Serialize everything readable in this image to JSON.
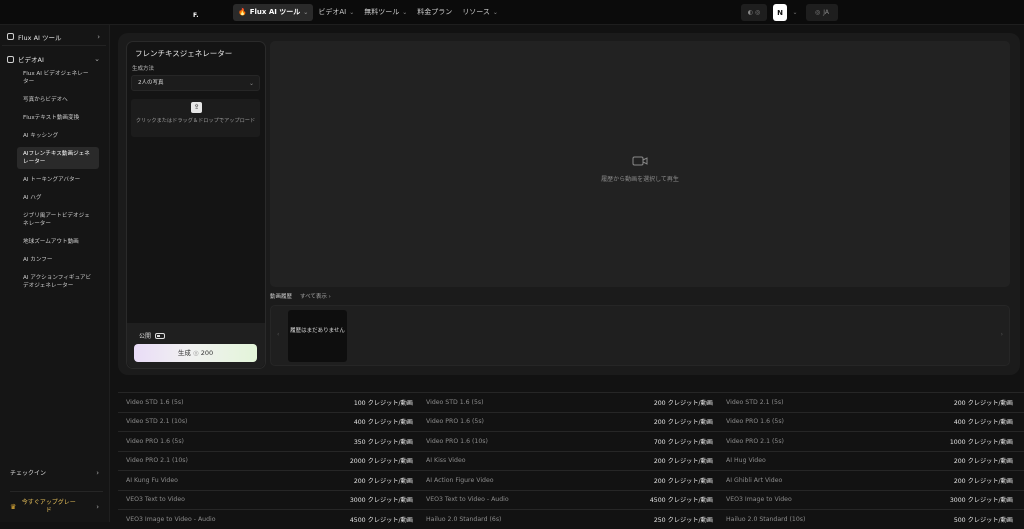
{
  "topbar": {
    "logo": "F",
    "nav": [
      {
        "label": "Flux AI ツール",
        "active": true
      },
      {
        "label": "ビデオAI",
        "active": false
      },
      {
        "label": "無料ツール",
        "active": false
      },
      {
        "label": "料金プラン",
        "active": false
      },
      {
        "label": "リソース",
        "active": false
      }
    ],
    "theme_toggle": "◐ ◎",
    "user_initial": "N",
    "language": "JA"
  },
  "sidebar": {
    "sections": [
      {
        "label": "Flux AI ツール"
      },
      {
        "label": "ビデオAI"
      }
    ],
    "items": [
      "Flux AI ビデオジェネレーター",
      "写真からビデオへ",
      "Fluxテキスト動画変換",
      "AI キッシング",
      "AIフレンチキス動画ジェネレーター",
      "AI トーキングアバター",
      "AI ハグ",
      "ジブリ風アートビデオジェネレーター",
      "地球ズームアウト動画",
      "AI カンフー",
      "AI アクションフィギュアビデオジェネレーター"
    ],
    "checkin": "チェックイン",
    "upgrade": "今すぐアップグレード"
  },
  "panel": {
    "title": "フレンチキスジェネレーター",
    "method_label": "生成方法",
    "method_value": "2人の写真",
    "upload_text": "クリックまたはドラッグ＆ドロップでアップロード",
    "public_label": "公開",
    "generate_label": "生成",
    "generate_cost": "200"
  },
  "preview": {
    "text": "履歴から動画を選択して再生"
  },
  "history": {
    "title": "動画履歴",
    "show_all": "すべて表示",
    "empty": "履歴はまだありません"
  },
  "pricing": [
    [
      {
        "name": "Video STD 1.6 (5s)",
        "value": "100 クレジット/動画"
      },
      {
        "name": "Video STD 1.6 (5s)",
        "value": "200 クレジット/動画"
      },
      {
        "name": "Video STD 2.1 (5s)",
        "value": "200 クレジット/動画"
      }
    ],
    [
      {
        "name": "Video STD 2.1 (10s)",
        "value": "400 クレジット/動画"
      },
      {
        "name": "Video PRO 1.6 (5s)",
        "value": "200 クレジット/動画"
      },
      {
        "name": "Video PRO 1.6 (5s)",
        "value": "400 クレジット/動画"
      }
    ],
    [
      {
        "name": "Video PRO 1.6 (5s)",
        "value": "350 クレジット/動画"
      },
      {
        "name": "Video PRO 1.6 (10s)",
        "value": "700 クレジット/動画"
      },
      {
        "name": "Video PRO 2.1 (5s)",
        "value": "1000 クレジット/動画"
      }
    ],
    [
      {
        "name": "Video PRO 2.1 (10s)",
        "value": "2000 クレジット/動画"
      },
      {
        "name": "AI Kiss Video",
        "value": "200 クレジット/動画"
      },
      {
        "name": "AI Hug Video",
        "value": "200 クレジット/動画"
      }
    ],
    [
      {
        "name": "AI Kung Fu Video",
        "value": "200 クレジット/動画"
      },
      {
        "name": "AI Action Figure Video",
        "value": "200 クレジット/動画"
      },
      {
        "name": "AI Ghibli Art Video",
        "value": "200 クレジット/動画"
      }
    ],
    [
      {
        "name": "VEO3 Text to Video",
        "value": "3000 クレジット/動画"
      },
      {
        "name": "VEO3 Text to Video - Audio",
        "value": "4500 クレジット/動画"
      },
      {
        "name": "VEO3 Image to Video",
        "value": "3000 クレジット/動画"
      }
    ],
    [
      {
        "name": "VEO3 Image to Video - Audio",
        "value": "4500 クレジット/動画"
      },
      {
        "name": "Hailuo 2.0 Standard (6s)",
        "value": "250 クレジット/動画"
      },
      {
        "name": "Hailuo 2.0 Standard (10s)",
        "value": "500 クレジット/動画"
      }
    ]
  ]
}
